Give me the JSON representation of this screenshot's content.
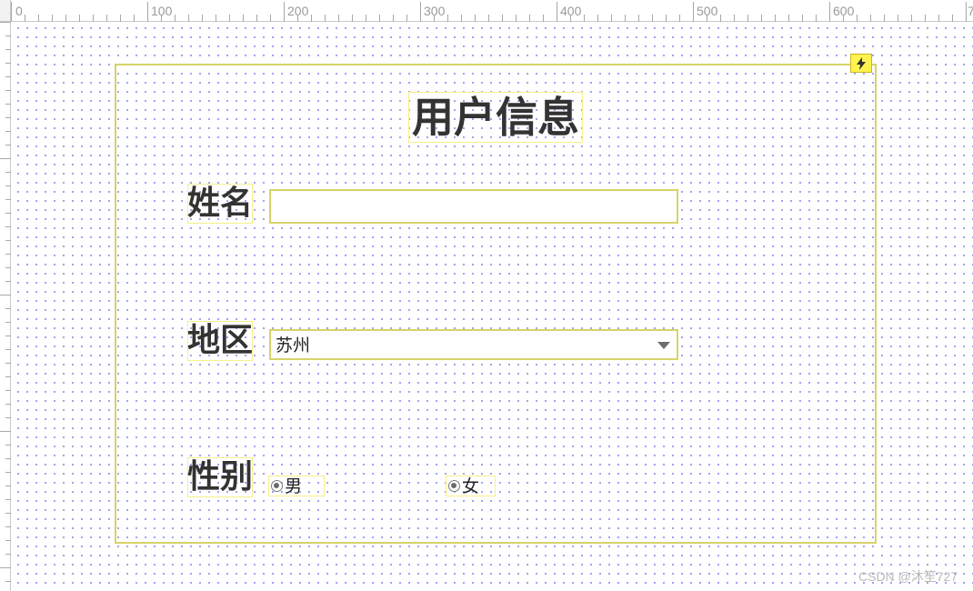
{
  "ruler": {
    "labels": [
      "0",
      "100",
      "200",
      "300",
      "400",
      "500",
      "600",
      "7"
    ]
  },
  "form": {
    "title": "用户信息",
    "name": {
      "label": "姓名",
      "value": "",
      "placeholder": ""
    },
    "region": {
      "label": "地区",
      "selected": "苏州"
    },
    "gender": {
      "label": "性别",
      "options": [
        "男",
        "女"
      ]
    }
  },
  "event_badge_icon": "lightning-icon",
  "accent_color": "#d6d36a",
  "watermark": "CSDN @沐笙727"
}
